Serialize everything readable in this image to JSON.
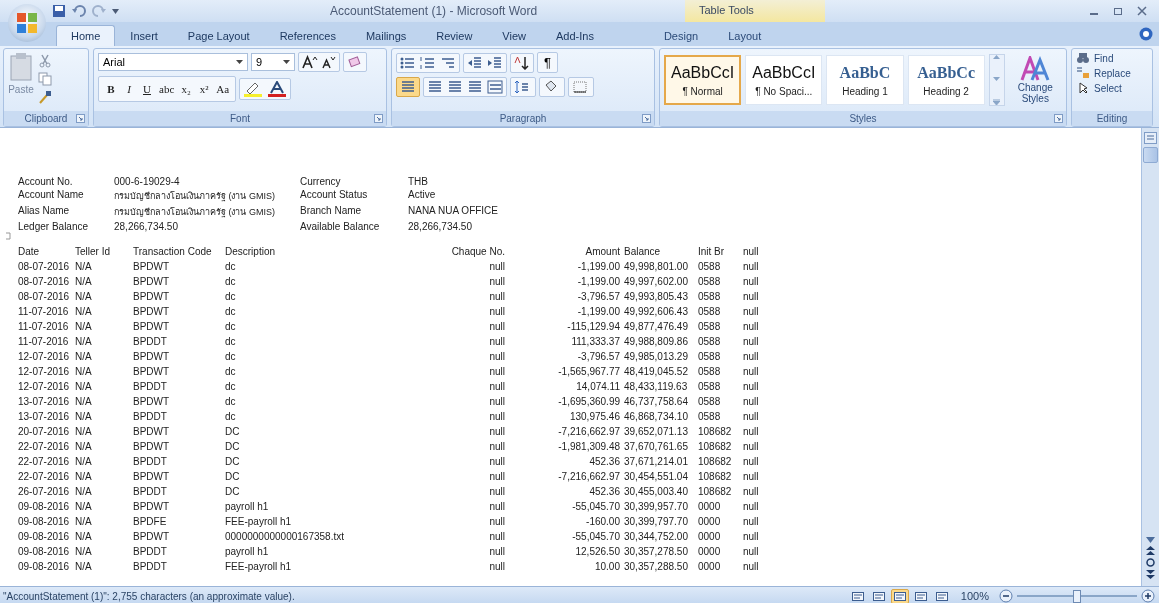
{
  "window": {
    "title": "AccountStatement (1) - Microsoft Word",
    "contextual_group": "Table Tools"
  },
  "tabs": [
    {
      "label": "Home",
      "selected": true,
      "kind": "standard"
    },
    {
      "label": "Insert",
      "selected": false,
      "kind": "standard"
    },
    {
      "label": "Page Layout",
      "selected": false,
      "kind": "standard"
    },
    {
      "label": "References",
      "selected": false,
      "kind": "standard"
    },
    {
      "label": "Mailings",
      "selected": false,
      "kind": "standard"
    },
    {
      "label": "Review",
      "selected": false,
      "kind": "standard"
    },
    {
      "label": "View",
      "selected": false,
      "kind": "standard"
    },
    {
      "label": "Add-Ins",
      "selected": false,
      "kind": "standard"
    },
    {
      "label": "Design",
      "selected": false,
      "kind": "contextual"
    },
    {
      "label": "Layout",
      "selected": false,
      "kind": "contextual"
    }
  ],
  "clipboard": {
    "paste_label": "Paste",
    "group_label": "Clipboard"
  },
  "font": {
    "name": "Arial",
    "size": "9",
    "buttons": [
      "B",
      "I",
      "U",
      "abc",
      "x₂",
      "x²",
      "Aa"
    ],
    "group_label": "Font"
  },
  "paragraph": {
    "pilcrow": "¶",
    "group_label": "Paragraph"
  },
  "styles": {
    "items": [
      {
        "preview": "AaBbCcI",
        "name": "¶ Normal",
        "selected": true,
        "kind": "body"
      },
      {
        "preview": "AaBbCcI",
        "name": "¶ No Spaci...",
        "selected": false,
        "kind": "body"
      },
      {
        "preview": "AaBbC",
        "name": "Heading 1",
        "selected": false,
        "kind": "heading"
      },
      {
        "preview": "AaBbCc",
        "name": "Heading 2",
        "selected": false,
        "kind": "heading"
      }
    ],
    "change_label": "Change Styles",
    "group_label": "Styles"
  },
  "editing": {
    "items": [
      "Find",
      "Replace",
      "Select"
    ],
    "group_label": "Editing"
  },
  "account_info": [
    {
      "label": "Account No.",
      "value": "000-6-19029-4",
      "label2": "Currency",
      "value2": "THB"
    },
    {
      "label": "Account Name",
      "value": "กรมบัญชีกลางโอนเงินภาครัฐ (งาน GMIS)",
      "label2": "Account Status",
      "value2": "Active"
    },
    {
      "label": "Alias Name",
      "value": "กรมบัญชีกลางโอนเงินภาครัฐ (งาน GMIS)",
      "label2": "Branch Name",
      "value2": "NANA NUA OFFICE"
    },
    {
      "label": "Ledger Balance",
      "value": "28,266,734.50",
      "label2": "Available Balance",
      "value2": "28,266,734.50"
    }
  ],
  "table": {
    "columns": [
      "Date",
      "Teller Id",
      "Transaction Code",
      "Description",
      "Chaque No.",
      "Amount",
      "Balance",
      "Init Br",
      "null"
    ],
    "rows": [
      [
        "08-07-2016",
        "N/A",
        "BPDWT",
        "dc",
        "null",
        "-1,199.00",
        "49,998,801.00",
        "0588",
        "null"
      ],
      [
        "08-07-2016",
        "N/A",
        "BPDWT",
        "dc",
        "null",
        "-1,199.00",
        "49,997,602.00",
        "0588",
        "null"
      ],
      [
        "08-07-2016",
        "N/A",
        "BPDWT",
        "dc",
        "null",
        "-3,796.57",
        "49,993,805.43",
        "0588",
        "null"
      ],
      [
        "11-07-2016",
        "N/A",
        "BPDWT",
        "dc",
        "null",
        "-1,199.00",
        "49,992,606.43",
        "0588",
        "null"
      ],
      [
        "11-07-2016",
        "N/A",
        "BPDWT",
        "dc",
        "null",
        "-115,129.94",
        "49,877,476.49",
        "0588",
        "null"
      ],
      [
        "11-07-2016",
        "N/A",
        "BPDDT",
        "dc",
        "null",
        "111,333.37",
        "49,988,809.86",
        "0588",
        "null"
      ],
      [
        "12-07-2016",
        "N/A",
        "BPDWT",
        "dc",
        "null",
        "-3,796.57",
        "49,985,013.29",
        "0588",
        "null"
      ],
      [
        "12-07-2016",
        "N/A",
        "BPDWT",
        "dc",
        "null",
        "-1,565,967.77",
        "48,419,045.52",
        "0588",
        "null"
      ],
      [
        "12-07-2016",
        "N/A",
        "BPDDT",
        "dc",
        "null",
        "14,074.11",
        "48,433,119.63",
        "0588",
        "null"
      ],
      [
        "13-07-2016",
        "N/A",
        "BPDWT",
        "dc",
        "null",
        "-1,695,360.99",
        "46,737,758.64",
        "0588",
        "null"
      ],
      [
        "13-07-2016",
        "N/A",
        "BPDDT",
        "dc",
        "null",
        "130,975.46",
        "46,868,734.10",
        "0588",
        "null"
      ],
      [
        "20-07-2016",
        "N/A",
        "BPDWT",
        "DC",
        "null",
        "-7,216,662.97",
        "39,652,071.13",
        "108682",
        "null"
      ],
      [
        "22-07-2016",
        "N/A",
        "BPDWT",
        "DC",
        "null",
        "-1,981,309.48",
        "37,670,761.65",
        "108682",
        "null"
      ],
      [
        "22-07-2016",
        "N/A",
        "BPDDT",
        "DC",
        "null",
        "452.36",
        "37,671,214.01",
        "108682",
        "null"
      ],
      [
        "22-07-2016",
        "N/A",
        "BPDWT",
        "DC",
        "null",
        "-7,216,662.97",
        "30,454,551.04",
        "108682",
        "null"
      ],
      [
        "26-07-2016",
        "N/A",
        "BPDDT",
        "DC",
        "null",
        "452.36",
        "30,455,003.40",
        "108682",
        "null"
      ],
      [
        "09-08-2016",
        "N/A",
        "BPDWT",
        "payroll h1",
        "null",
        "-55,045.70",
        "30,399,957.70",
        "0000",
        "null"
      ],
      [
        "09-08-2016",
        "N/A",
        "BPDFE",
        "FEE-payroll h1",
        "null",
        "-160.00",
        "30,399,797.70",
        "0000",
        "null"
      ],
      [
        "09-08-2016",
        "N/A",
        "BPDWT",
        "0000000000000167358.txt",
        "null",
        "-55,045.70",
        "30,344,752.00",
        "0000",
        "null"
      ],
      [
        "09-08-2016",
        "N/A",
        "BPDDT",
        "payroll h1",
        "null",
        "12,526.50",
        "30,357,278.50",
        "0000",
        "null"
      ],
      [
        "09-08-2016",
        "N/A",
        "BPDDT",
        "FEE-payroll h1",
        "null",
        "10.00",
        "30,357,288.50",
        "0000",
        "null"
      ]
    ]
  },
  "status_bar": {
    "text": "\"AccountStatement (1)\": 2,755 characters (an approximate value).",
    "views": [
      {
        "selected": false
      },
      {
        "selected": false
      },
      {
        "selected": true
      },
      {
        "selected": false
      },
      {
        "selected": false
      }
    ],
    "zoom": "100%",
    "zoom_slider": {
      "level": 0.5
    }
  }
}
